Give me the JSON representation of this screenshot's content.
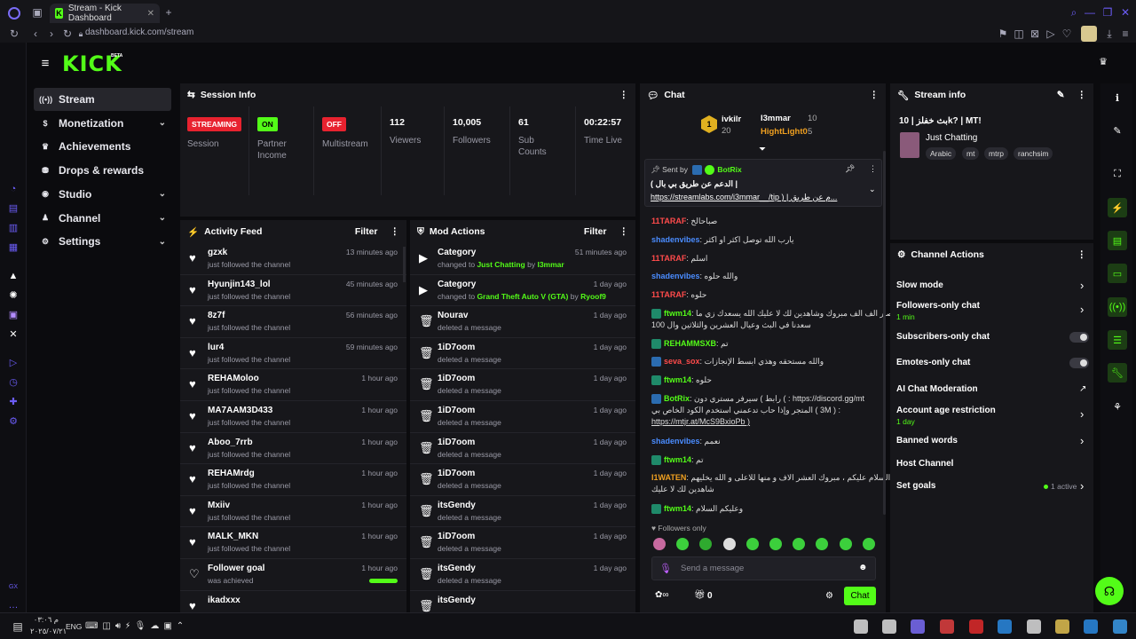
{
  "browser": {
    "tab_title": "Stream - Kick Dashboard",
    "url": "dashboard.kick.com/stream"
  },
  "brand": {
    "logo": "KICK",
    "beta": "BETA",
    "accent": "#53fc18"
  },
  "nav": [
    {
      "label": "Stream",
      "icon": "broadcast-icon",
      "active": true
    },
    {
      "label": "Monetization",
      "icon": "dollar-icon",
      "chevron": true
    },
    {
      "label": "Achievements",
      "icon": "trophy-icon"
    },
    {
      "label": "Drops & rewards",
      "icon": "gift-icon"
    },
    {
      "label": "Studio",
      "icon": "camera-icon",
      "chevron": true
    },
    {
      "label": "Channel",
      "icon": "user-icon",
      "chevron": true
    },
    {
      "label": "Settings",
      "icon": "gear-icon",
      "chevron": true
    }
  ],
  "session": {
    "title": "Session Info",
    "items": [
      {
        "badge": "STREAMING",
        "badge_color": "#e8222f",
        "label": "Session"
      },
      {
        "badge": "ON",
        "badge_color": "#53fc18",
        "label": "Partner Income"
      },
      {
        "badge": "OFF",
        "badge_color": "#e8222f",
        "label": "Multistream"
      },
      {
        "value": "112",
        "label": "Viewers"
      },
      {
        "value": "10,005",
        "label": "Followers"
      },
      {
        "value": "61",
        "label": "Sub Counts"
      },
      {
        "value": "00:22:57",
        "label": "Time Live"
      }
    ]
  },
  "activity": {
    "title": "Activity Feed",
    "filter": "Filter",
    "rows": [
      {
        "name": "gzxk",
        "sub": "just followed the channel",
        "time": "13 minutes ago"
      },
      {
        "name": "Hyunjin143_lol",
        "sub": "just followed the channel",
        "time": "45 minutes ago"
      },
      {
        "name": "8z7f",
        "sub": "just followed the channel",
        "time": "56 minutes ago"
      },
      {
        "name": "lur4",
        "sub": "just followed the channel",
        "time": "59 minutes ago"
      },
      {
        "name": "REHAMoloo",
        "sub": "just followed the channel",
        "time": "1 hour ago"
      },
      {
        "name": "MA7AAM3D433",
        "sub": "just followed the channel",
        "time": "1 hour ago"
      },
      {
        "name": "Aboo_7rrb",
        "sub": "just followed the channel",
        "time": "1 hour ago"
      },
      {
        "name": "REHAMrdg",
        "sub": "just followed the channel",
        "time": "1 hour ago"
      },
      {
        "name": "Mxiiv",
        "sub": "just followed the channel",
        "time": "1 hour ago"
      },
      {
        "name": "MALK_MKN",
        "sub": "just followed the channel",
        "time": "1 hour ago"
      },
      {
        "name": "Follower goal",
        "sub": "was achieved",
        "time": "1 hour ago",
        "goal": true
      },
      {
        "name": "ikadxxx",
        "sub": "",
        "time": ""
      }
    ]
  },
  "mod": {
    "title": "Mod Actions",
    "filter": "Filter",
    "rows": [
      {
        "name": "Category",
        "pre": "changed to ",
        "hl": "Just Chatting",
        "mid": " by ",
        "by": "I3mmar",
        "time": "51 minutes ago",
        "icon": "category-icon"
      },
      {
        "name": "Category",
        "pre": "changed to ",
        "hl": "Grand Theft Auto V (GTA)",
        "mid": " by ",
        "by": "Ryoof9",
        "time": "1 day ago",
        "icon": "category-icon"
      },
      {
        "name": "Nourav",
        "sub": "deleted a message",
        "time": "1 day ago",
        "icon": "trash-icon"
      },
      {
        "name": "1iD7oom",
        "sub": "deleted a message",
        "time": "1 day ago",
        "icon": "trash-icon"
      },
      {
        "name": "1iD7oom",
        "sub": "deleted a message",
        "time": "1 day ago",
        "icon": "trash-icon"
      },
      {
        "name": "1iD7oom",
        "sub": "deleted a message",
        "time": "1 day ago",
        "icon": "trash-icon"
      },
      {
        "name": "1iD7oom",
        "sub": "deleted a message",
        "time": "1 day ago",
        "icon": "trash-icon"
      },
      {
        "name": "1iD7oom",
        "sub": "deleted a message",
        "time": "1 day ago",
        "icon": "trash-icon"
      },
      {
        "name": "itsGendy",
        "sub": "deleted a message",
        "time": "1 day ago",
        "icon": "trash-icon"
      },
      {
        "name": "1iD7oom",
        "sub": "deleted a message",
        "time": "1 day ago",
        "icon": "trash-icon"
      },
      {
        "name": "itsGendy",
        "sub": "deleted a message",
        "time": "1 day ago",
        "icon": "trash-icon"
      },
      {
        "name": "itsGendy",
        "sub": "",
        "time": "",
        "icon": "trash-icon"
      }
    ]
  },
  "chat": {
    "title": "Chat",
    "leaders": [
      {
        "name": "ivkilr",
        "count": "20",
        "color": "#ffffff"
      },
      {
        "name": "I3mmar",
        "count": "10",
        "color": "#ffffff"
      },
      {
        "name": "HightLight0",
        "count": "5",
        "color": "#f0a020"
      }
    ],
    "pinned": {
      "sent_by": "Sent by",
      "author": "BotRix",
      "line1": "( الدعم عن طريق بي بال |",
      "line2": "https://streamlabs.com/i3mmar__/tip ) | م عن طريق..."
    },
    "messages": [
      {
        "user": "11TARAF",
        "text": "صباحالخ",
        "color": "#ff4b4b"
      },
      {
        "user": "shadenvibes",
        "text": "يارب الله توصل اكثر او اكثر",
        "color": "#4a8cff"
      },
      {
        "user": "11TARAF",
        "text": "اسلم",
        "color": "#ff4b4b"
      },
      {
        "user": "shadenvibes",
        "text": "والله حلوه",
        "color": "#4a8cff"
      },
      {
        "user": "11TARAF",
        "text": "حلوه",
        "color": "#ff4b4b"
      },
      {
        "user": "ftwm14",
        "text": "عصار الف الف مبروك وشاهدين لك لا عليك الله يسعدك زي ما",
        "text2": "سعدنا في البث وعيال العشرين والثلاثين وال 100",
        "color": "#53fc18"
      },
      {
        "user": "REHAMMSXB",
        "text": "تم",
        "color": "#53fc18"
      },
      {
        "user": "seva_sox",
        "text": "والله مستحقه وهذي ابسط الإنجازات",
        "color": "#ff4b4b"
      },
      {
        "user": "ftwm14",
        "text": "حلوه",
        "color": "#53fc18"
      },
      {
        "user": "BotRix",
        "text": "رابط ) سيرفر مستري دون ( : https://discord.gg/mt",
        "text2": "المتجر وإذا حاب تدعمني استخدم الكود الخاص بي ( 3M ) :",
        "text3": "https://mtjr.at/McS9BxioPb )",
        "color": "#53fc18"
      },
      {
        "user": "shadenvibes",
        "text": "نعمم",
        "color": "#4a8cff"
      },
      {
        "user": "ftwm14",
        "text": "تم",
        "color": "#53fc18"
      },
      {
        "user": "I1WATEN",
        "text": "السلام عليكم ، مبروك العشر الاف و منها للاعلى و الله يخليهم",
        "text2": "شاهدين لك لا عليك",
        "color": "#f0a020"
      },
      {
        "user": "ftwm14",
        "text": "وعليكم السلام",
        "color": "#53fc18"
      }
    ],
    "followers_only": "Followers only",
    "placeholder": "Send a message",
    "send": "Chat",
    "points": "0"
  },
  "streaminfo": {
    "title": "Stream info",
    "stream_title": "بث خفلز | 10k? | MT!",
    "category": "Just Chatting",
    "tags": [
      "Arabic",
      "mt",
      "mtrp",
      "ranchsim"
    ]
  },
  "channel_actions": {
    "title": "Channel Actions",
    "items": [
      {
        "label": "Slow mode",
        "kind": "arrow"
      },
      {
        "label": "Followers-only chat",
        "sub": "1 min",
        "kind": "arrow"
      },
      {
        "label": "Subscribers-only chat",
        "kind": "toggle"
      },
      {
        "label": "Emotes-only chat",
        "kind": "toggle"
      },
      {
        "label": "AI Chat Moderation",
        "kind": "external"
      },
      {
        "label": "Account age restriction",
        "sub": "1 day",
        "kind": "arrow"
      },
      {
        "label": "Banned words",
        "kind": "arrow"
      },
      {
        "label": "Host Channel",
        "kind": "none"
      },
      {
        "label": "Set goals",
        "status": "1 active",
        "kind": "arrow"
      }
    ]
  },
  "taskbar": {
    "date_line1": "م ٠٣:٠٦",
    "date_line2": "٢٠٢٥/٠٧/٢١",
    "lang": "ENG",
    "gx": "GX"
  }
}
